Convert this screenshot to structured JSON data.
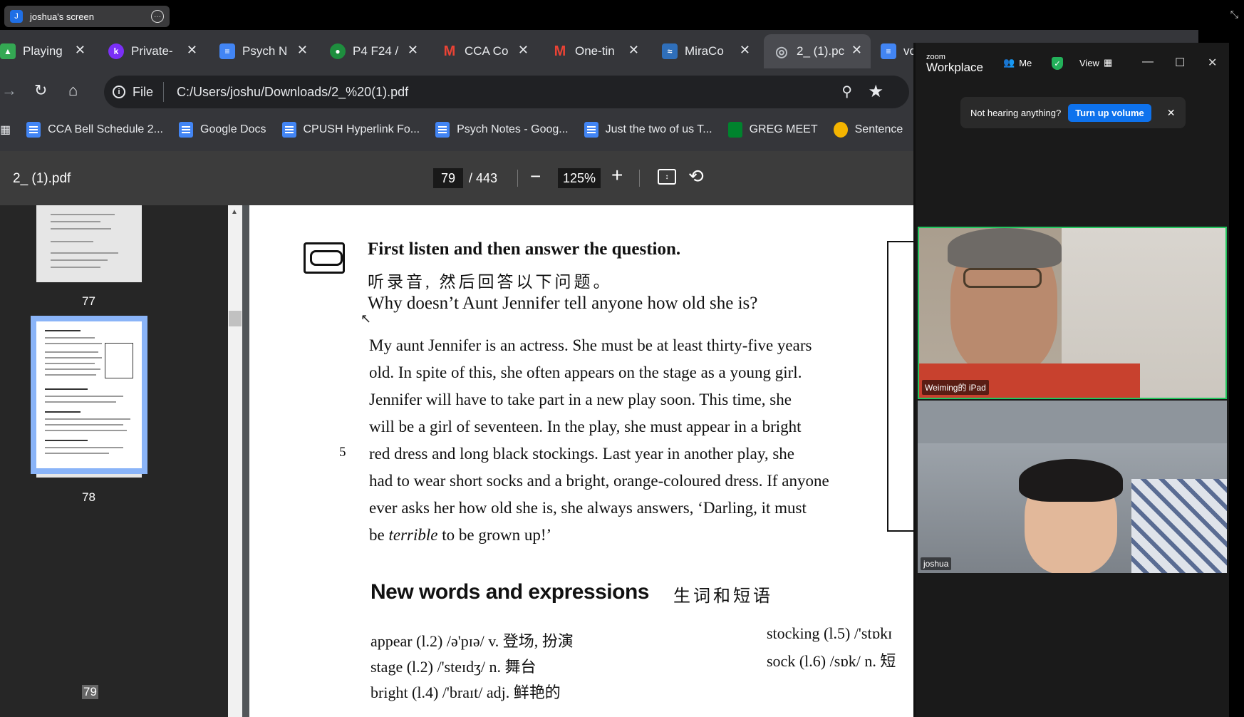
{
  "share_bar": {
    "badge": "J",
    "title": "joshua's screen"
  },
  "tabs": [
    {
      "label": "Playing",
      "icon": "google-drive-icon",
      "color": "#34a853"
    },
    {
      "label": "Private-",
      "icon": "k-app-icon",
      "color": "#7b2ff7"
    },
    {
      "label": "Psych N",
      "icon": "google-docs-icon",
      "color": "#4285f4"
    },
    {
      "label": "P4 F24 /",
      "icon": "google-classroom-icon",
      "color": "#1e8e3e"
    },
    {
      "label": "CCA Co",
      "icon": "gmail-icon",
      "color": "#ea4335"
    },
    {
      "label": "One-tin",
      "icon": "gmail-icon",
      "color": "#ea4335"
    },
    {
      "label": "MiraCo",
      "icon": "miracosta-icon",
      "color": "#2f6fba"
    },
    {
      "label": "2_ (1).pc",
      "icon": "globe-icon",
      "color": "#9aa0a6"
    },
    {
      "label": "vc",
      "icon": "google-docs-icon",
      "color": "#4285f4"
    }
  ],
  "toolbar": {
    "file_chip": "File",
    "url": "C:/Users/joshu/Downloads/2_%20(1).pdf"
  },
  "bookmarks": [
    {
      "label": "CCA Bell Schedule 2..."
    },
    {
      "label": "Google Docs"
    },
    {
      "label": "CPUSH Hyperlink Fo..."
    },
    {
      "label": "Psych Notes - Goog..."
    },
    {
      "label": "Just the two of us T..."
    },
    {
      "label": "GREG MEET"
    },
    {
      "label": "Sentence"
    }
  ],
  "pdf_viewer": {
    "title": "2_ (1).pdf",
    "page_current": "79",
    "page_total": "/ 443",
    "zoom": "125%",
    "thumbnails": [
      {
        "label": "77"
      },
      {
        "label": "78"
      },
      {
        "label": "79",
        "selected": true
      }
    ]
  },
  "pdf_page": {
    "heading": "First listen and then answer the question.",
    "heading_cn": "听录音, 然后回答以下问题。",
    "question": "Why doesn’t Aunt Jennifer tell anyone how old she is?",
    "line_number": "5",
    "passage_lines": [
      "My aunt Jennifer is an actress. She must be at least thirty-five years",
      "old. In spite of this, she often appears on the stage as a young girl.",
      "Jennifer will have to take part in a new play soon. This time, she",
      "will be a girl of seventeen. In the play, she must appear in a bright",
      "red dress and long black stockings. Last year in another play, she",
      "had to wear short socks and a bright, orange-coloured dress. If anyone",
      "ever asks her how old she is, she always answers, ‘Darling, it must"
    ],
    "passage_last_pre": "be ",
    "passage_last_em": "terrible",
    "passage_last_post": " to be grown up!’",
    "new_words_heading": "New words and expressions",
    "new_words_heading_cn": "生词和短语",
    "vocab": [
      "appear (l.2) /ə'pɪə/ v. 登场, 扮演",
      "stage (l.2) /'steɪdʒ/ n. 舞台",
      "bright (l.4) /'braɪt/ adj. 鲜艳的",
      "stocking (l.5) /'stɒkɪ",
      "sock (l.6) /sɒk/ n. 短"
    ]
  },
  "zoom": {
    "brand_small": "zoom",
    "brand": "Workplace",
    "tool_me": "Me",
    "tool_view": "View",
    "notice_text": "Not hearing anything?",
    "notice_button": "Turn up volume",
    "participants": [
      {
        "name": "Weiming的 iPad",
        "active_speaker": true
      },
      {
        "name": "joshua",
        "active_speaker": false
      }
    ]
  }
}
